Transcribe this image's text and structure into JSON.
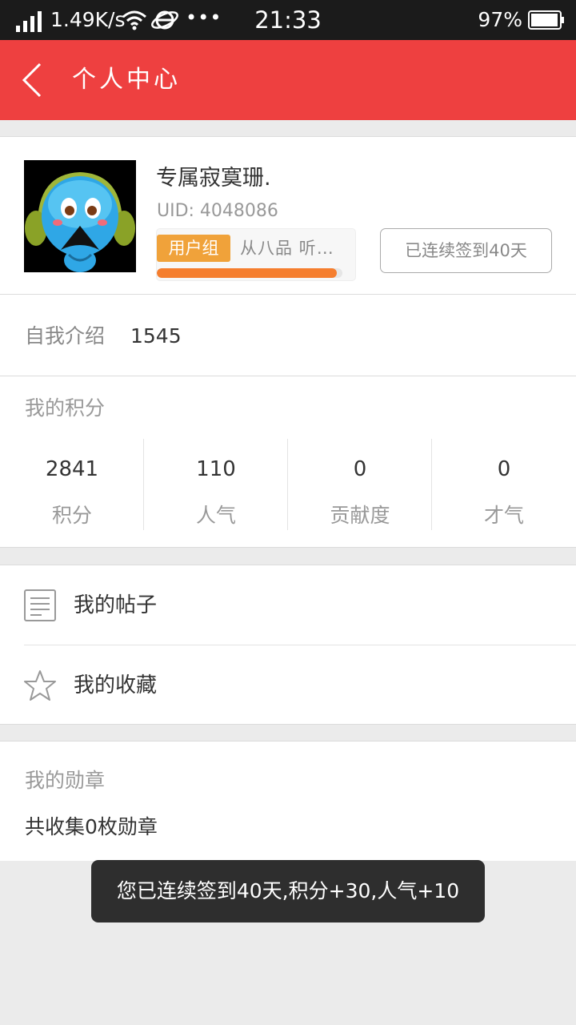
{
  "status_bar": {
    "net_speed": "1.49K/s",
    "extra": "•••",
    "time": "21:33",
    "battery": "97%",
    "battery_level": 0.97,
    "icons": [
      "signal-icon",
      "wifi-icon",
      "ie-icon",
      "battery-icon"
    ]
  },
  "header": {
    "title": "个人中心",
    "back_icon": "chevron-left-icon",
    "bg_color": "#ee4040"
  },
  "profile": {
    "username": "专属寂寞珊.",
    "uid": "UID: 4048086",
    "group_badge": "用户组",
    "group_name": "从八品 听雨轩",
    "level_progress": 0.97,
    "checkin_label": "已连续签到40天"
  },
  "intro": {
    "label": "自我介绍",
    "value": "1545"
  },
  "points": {
    "title": "我的积分",
    "stats": [
      {
        "value": "2841",
        "label": "积分"
      },
      {
        "value": "110",
        "label": "人气"
      },
      {
        "value": "0",
        "label": "贡献度"
      },
      {
        "value": "0",
        "label": "才气"
      }
    ]
  },
  "menu": [
    {
      "label": "我的帖子",
      "icon": "document-icon"
    },
    {
      "label": "我的收藏",
      "icon": "star-icon"
    }
  ],
  "medals": {
    "title": "我的勋章",
    "summary": "共收集0枚勋章"
  },
  "toast": {
    "message": "您已连续签到40天,积分+30,人气+10"
  }
}
